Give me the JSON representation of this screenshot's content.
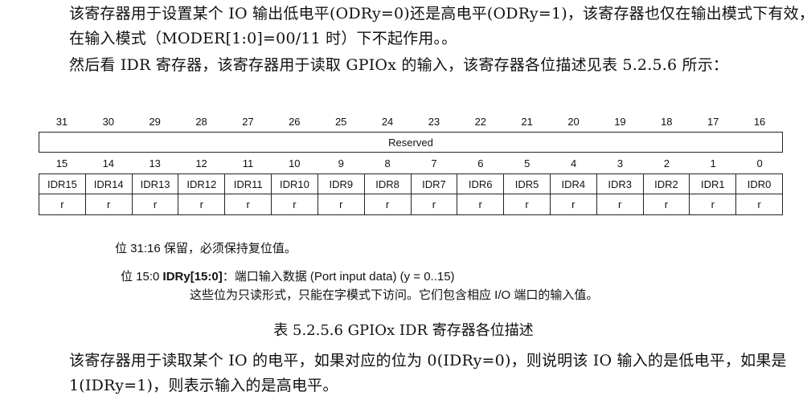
{
  "paragraphs": {
    "p1": "该寄存器用于设置某个 IO 输出低电平(ODRy=0)还是高电平(ODRy=1)，该寄存器也仅在输出模式下有效，在输入模式（MODER[1:0]=00/11 时）下不起作用。。",
    "p2": "然后看 IDR 寄存器，该寄存器用于读取 GPIOx 的输入，该寄存器各位描述见表 5.2.5.6 所示：",
    "p3": "该寄存器用于读取某个 IO 的电平，如果对应的位为 0(IDRy=0)，则说明该 IO 输入的是低电平，如果是 1(IDRy=1)，则表示输入的是高电平。"
  },
  "register": {
    "upper_bits": [
      "31",
      "30",
      "29",
      "28",
      "27",
      "26",
      "25",
      "24",
      "23",
      "22",
      "21",
      "20",
      "19",
      "18",
      "17",
      "16"
    ],
    "reserved_label": "Reserved",
    "lower_bits": [
      "15",
      "14",
      "13",
      "12",
      "11",
      "10",
      "9",
      "8",
      "7",
      "6",
      "5",
      "4",
      "3",
      "2",
      "1",
      "0"
    ],
    "fields": [
      "IDR15",
      "IDR14",
      "IDR13",
      "IDR12",
      "IDR11",
      "IDR10",
      "IDR9",
      "IDR8",
      "IDR7",
      "IDR6",
      "IDR5",
      "IDR4",
      "IDR3",
      "IDR2",
      "IDR1",
      "IDR0"
    ],
    "access": [
      "r",
      "r",
      "r",
      "r",
      "r",
      "r",
      "r",
      "r",
      "r",
      "r",
      "r",
      "r",
      "r",
      "r",
      "r",
      "r"
    ]
  },
  "description": {
    "line1": "位 31:16  保留，必须保持复位值。",
    "line2_prefix": "位 15:0  ",
    "line2_field": "IDRy[15:0]",
    "line2_rest": "：端口输入数据 (Port input data) (y = 0..15)",
    "line3": "这些位为只读形式，只能在字模式下访问。它们包含相应 I/O 端口的输入值。"
  },
  "caption": "表 5.2.5.6 GPIOx IDR 寄存器各位描述"
}
